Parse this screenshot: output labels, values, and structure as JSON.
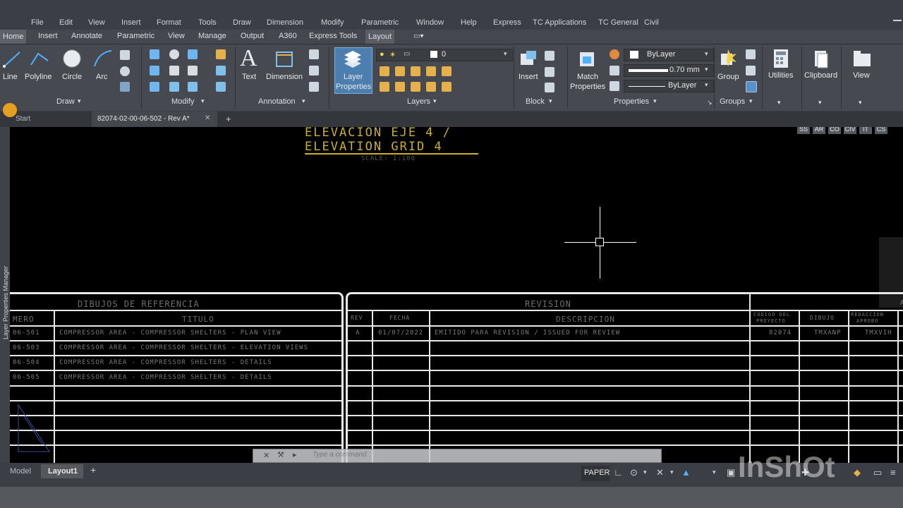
{
  "menu": [
    "File",
    "Edit",
    "View",
    "Insert",
    "Format",
    "Tools",
    "Draw",
    "Dimension",
    "Modify",
    "Parametric",
    "Window",
    "Help",
    "Express",
    "TC Applications",
    "TC General",
    "Civil"
  ],
  "ribbon_tabs": [
    "Home",
    "Insert",
    "Annotate",
    "Parametric",
    "View",
    "Manage",
    "Output",
    "A360",
    "Express Tools",
    "Layout"
  ],
  "active_tab": "Layout",
  "tools": {
    "line": "Line",
    "polyline": "Polyline",
    "circle": "Circle",
    "arc": "Arc",
    "text": "Text",
    "dimension": "Dimension",
    "layer_properties_1": "Layer",
    "layer_properties_2": "Properties",
    "insert": "Insert",
    "match_properties_1": "Match",
    "match_properties_2": "Properties",
    "group": "Group",
    "utilities": "Utilities",
    "clipboard": "Clipboard",
    "view": "View"
  },
  "panels": {
    "draw": "Draw",
    "modify": "Modify",
    "annotation": "Annotation",
    "layers": "Layers",
    "block": "Block",
    "properties": "Properties",
    "groups": "Groups"
  },
  "layer_dropdown": "0",
  "properties_panel": {
    "color": "ByLayer",
    "lineweight": "0.70 mm",
    "linetype": "ByLayer"
  },
  "doc_tabs": {
    "start": "Start",
    "drawing": "82074-02-00-06-502 - Rev A*"
  },
  "side_palette": "Layer Properties Manager",
  "tc_buttons": [
    "SS",
    "AR",
    "CO",
    "CIV",
    "IT",
    "CS"
  ],
  "drawing": {
    "title_1": "ELEVACION EJE 4 /",
    "title_2": "ELEVATION GRID 4",
    "scale": "SCALE: 1:100",
    "ref_header": "DIBUJOS DE REFERENCIA",
    "col_numero": "MERO",
    "col_titulo": "TITULO",
    "ref_rows": [
      {
        "num": "06-501",
        "title": "COMPRESSOR AREA - COMPRESSOR SHELTERS - PLAN VIEW"
      },
      {
        "num": "06-503",
        "title": "COMPRESSOR AREA - COMPRESSOR SHELTERS - ELEVATION VIEWS"
      },
      {
        "num": "06-504",
        "title": "COMPRESSOR AREA - COMPRESSOR SHELTERS - DETAILS"
      },
      {
        "num": "06-505",
        "title": "COMPRESSOR AREA - COMPRESSOR SHELTERS - DETAILS"
      }
    ],
    "rev_header": "REVISION",
    "col_rev": "REV",
    "col_fecha": "FECHA",
    "col_descripcion": "DESCRIPCION",
    "col_codigo_1": "CODIGO DEL",
    "col_codigo_2": "PROYECTO",
    "col_dibujo": "DIBUJO",
    "col_redaccion_1": "REDACCION",
    "col_redaccion_2": "APROBO",
    "col_ap": "AP",
    "rev_row": {
      "rev": "A",
      "fecha": "01/07/2022",
      "desc": "EMITIDO PARA REVISION / ISSUED FOR REVIEW",
      "codigo": "82074",
      "dibujo": "TMXANP",
      "redaccion": "TMXVIH"
    }
  },
  "command_placeholder": "Type a command",
  "layout_tabs": {
    "model": "Model",
    "layout1": "Layout1"
  },
  "status": {
    "paper": "PAPER"
  },
  "watermark": "InShOt"
}
